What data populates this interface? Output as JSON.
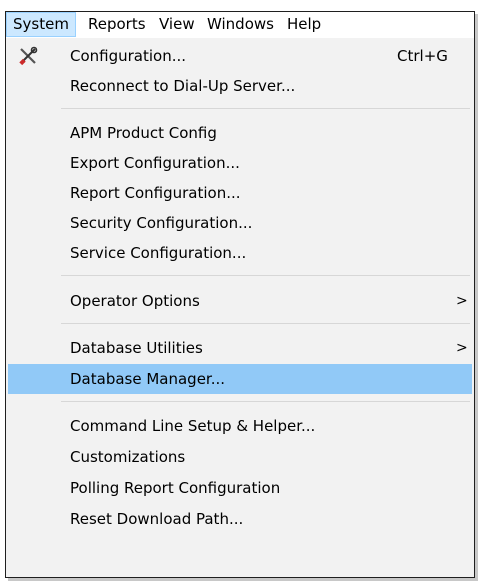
{
  "menubar": {
    "system": "System",
    "reports": "Reports",
    "view": "View",
    "windows": "Windows",
    "help": "Help"
  },
  "system_menu": {
    "configuration": {
      "label": "Configuration...",
      "shortcut": "Ctrl+G",
      "icon": "tools-icon"
    },
    "reconnect": "Reconnect to Dial-Up Server...",
    "apm_product_config": "APM Product Config",
    "export_configuration": "Export Configuration...",
    "report_configuration": "Report Configuration...",
    "security_configuration": "Security Configuration...",
    "service_configuration": "Service Configuration...",
    "operator_options": {
      "label": "Operator Options",
      "arrow": ">"
    },
    "database_utilities": {
      "label": "Database Utilities",
      "arrow": ">"
    },
    "database_manager": "Database Manager...",
    "command_line_setup": "Command Line Setup & Helper...",
    "customizations": "Customizations",
    "polling_report_configuration": "Polling Report Configuration",
    "reset_download_path": "Reset Download Path..."
  },
  "colors": {
    "menubar_active_bg": "#cce8ff",
    "highlight_bg": "#91c9f7",
    "menu_bg": "#f2f2f2"
  }
}
